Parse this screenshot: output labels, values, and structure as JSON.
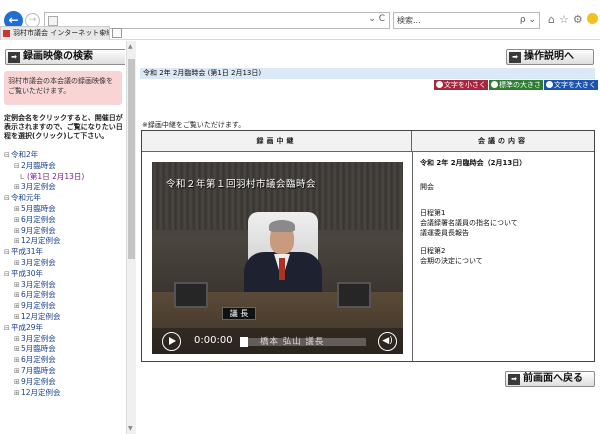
{
  "browser": {
    "search_placeholder": "検索...",
    "tab_title": "羽村市議会 インターネット中継",
    "back_glyph": "←",
    "forward_glyph": "→",
    "refresh_glyph": "⌄ C",
    "search_glyph": "ρ ⌄"
  },
  "sidebar": {
    "search_button": "録画映像の検索",
    "notice": "羽村市議会の本会議の録画映像をご覧いただけます。",
    "instruction": "定例会名をクリックすると、開催日が表示されますので、ご覧になりたい日程を選択(クリック)して下さい。",
    "tree": [
      {
        "level": 1,
        "toggle": "⊟",
        "label": "令和2年"
      },
      {
        "level": 2,
        "toggle": "⊟",
        "label": "2月臨時会"
      },
      {
        "level": 3,
        "toggle": "L",
        "label": "(第1日 2月13日)"
      },
      {
        "level": 2,
        "toggle": "⊞",
        "label": "3月定例会"
      },
      {
        "level": 1,
        "toggle": "⊟",
        "label": "令和元年"
      },
      {
        "level": 2,
        "toggle": "⊞",
        "label": "5月臨時会"
      },
      {
        "level": 2,
        "toggle": "⊞",
        "label": "6月定例会"
      },
      {
        "level": 2,
        "toggle": "⊞",
        "label": "9月定例会"
      },
      {
        "level": 2,
        "toggle": "⊞",
        "label": "12月定例会"
      },
      {
        "level": 1,
        "toggle": "⊟",
        "label": "平成31年"
      },
      {
        "level": 2,
        "toggle": "⊞",
        "label": "3月定例会"
      },
      {
        "level": 1,
        "toggle": "⊟",
        "label": "平成30年"
      },
      {
        "level": 2,
        "toggle": "⊞",
        "label": "3月定例会"
      },
      {
        "level": 2,
        "toggle": "⊞",
        "label": "6月定例会"
      },
      {
        "level": 2,
        "toggle": "⊞",
        "label": "9月定例会"
      },
      {
        "level": 2,
        "toggle": "⊞",
        "label": "12月定例会"
      },
      {
        "level": 1,
        "toggle": "⊟",
        "label": "平成29年"
      },
      {
        "level": 2,
        "toggle": "⊞",
        "label": "3月定例会"
      },
      {
        "level": 2,
        "toggle": "⊞",
        "label": "5月臨時会"
      },
      {
        "level": 2,
        "toggle": "⊞",
        "label": "6月定例会"
      },
      {
        "level": 2,
        "toggle": "⊞",
        "label": "7月臨時会"
      },
      {
        "level": 2,
        "toggle": "⊞",
        "label": "9月定例会"
      },
      {
        "level": 2,
        "toggle": "⊞",
        "label": "12月定例会"
      }
    ]
  },
  "main": {
    "help_button": "操作説明へ",
    "page_title": "令和 2年 2月臨時会 (第1日 2月13日)",
    "font_size": {
      "smaller": "文字を小さく",
      "standard": "標準の大きさ",
      "larger": "文字を大きく"
    },
    "note": "※録画中継をご覧いただけます。",
    "table": {
      "col_live": "録画中継",
      "col_content": "会議の内容"
    },
    "video": {
      "caption": "令和２年第１回羽村市議会臨時会",
      "nameplate": "議 長",
      "subtitle": "橋本 弘山 議長",
      "time": "0:00:00",
      "seek_position": 0,
      "play_glyph": "",
      "volume_glyph": "◀)"
    },
    "content": {
      "title": "令和 2年 2月臨時会（2月13日）",
      "opening": "開会",
      "agenda1_head": "日程第1",
      "agenda1_line1": "会議録署名議員の指名について",
      "agenda1_line2": "議運委員長報告",
      "agenda2_head": "日程第2",
      "agenda2_line1": "会期の決定について"
    },
    "back_button": "前画面へ戻る"
  }
}
